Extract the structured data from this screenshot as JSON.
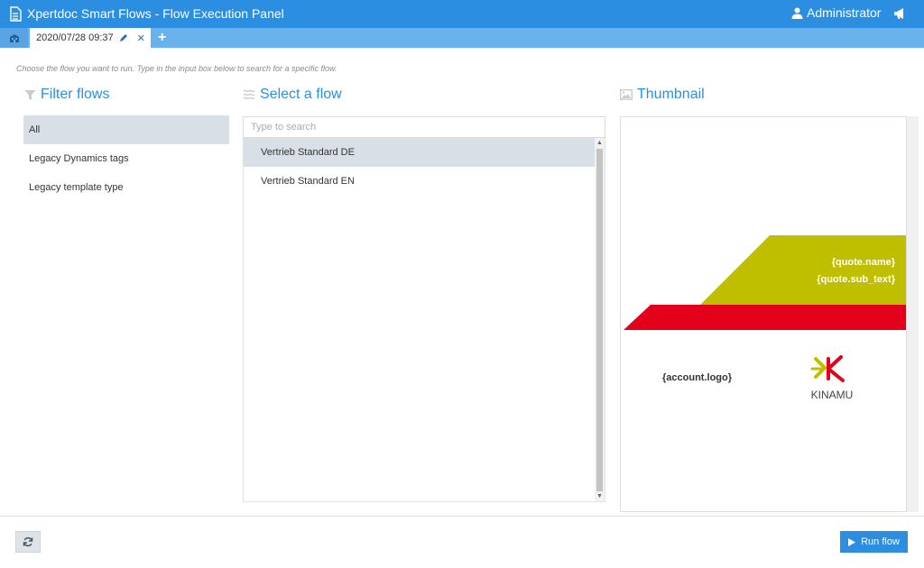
{
  "window": {
    "title": "Xpertdoc Smart Flows - Flow Execution Panel",
    "user": "Administrator",
    "icons": {
      "document": "document-icon",
      "user": "user-icon",
      "notifications": "megaphone-icon"
    }
  },
  "tabs": {
    "home_icon": "building-icon",
    "items": [
      {
        "label": "2020/07/28 09:37"
      }
    ],
    "add_label": "+"
  },
  "hint": "Choose the flow you want to run. Type in the input box below to search for a specific flow.",
  "filter": {
    "title": "Filter flows",
    "items": [
      {
        "label": "All",
        "selected": true
      },
      {
        "label": "Legacy Dynamics tags",
        "selected": false
      },
      {
        "label": "Legacy template type",
        "selected": false
      }
    ]
  },
  "flows": {
    "title": "Select a flow",
    "search_placeholder": "Type to search",
    "items": [
      {
        "label": "Vertrieb Standard DE",
        "selected": true
      },
      {
        "label": "Vertrieb Standard EN",
        "selected": false
      }
    ]
  },
  "thumbnail": {
    "title": "Thumbnail",
    "quote_name": "{quote.name}",
    "quote_sub_text": "{quote.sub_text}",
    "account_logo": "{account.logo}",
    "brand": "KINAMU",
    "colors": {
      "olive": "#bfbf00",
      "red": "#e3001b",
      "accent": "#2b8ee0"
    }
  },
  "footer": {
    "run_label": "Run flow"
  }
}
